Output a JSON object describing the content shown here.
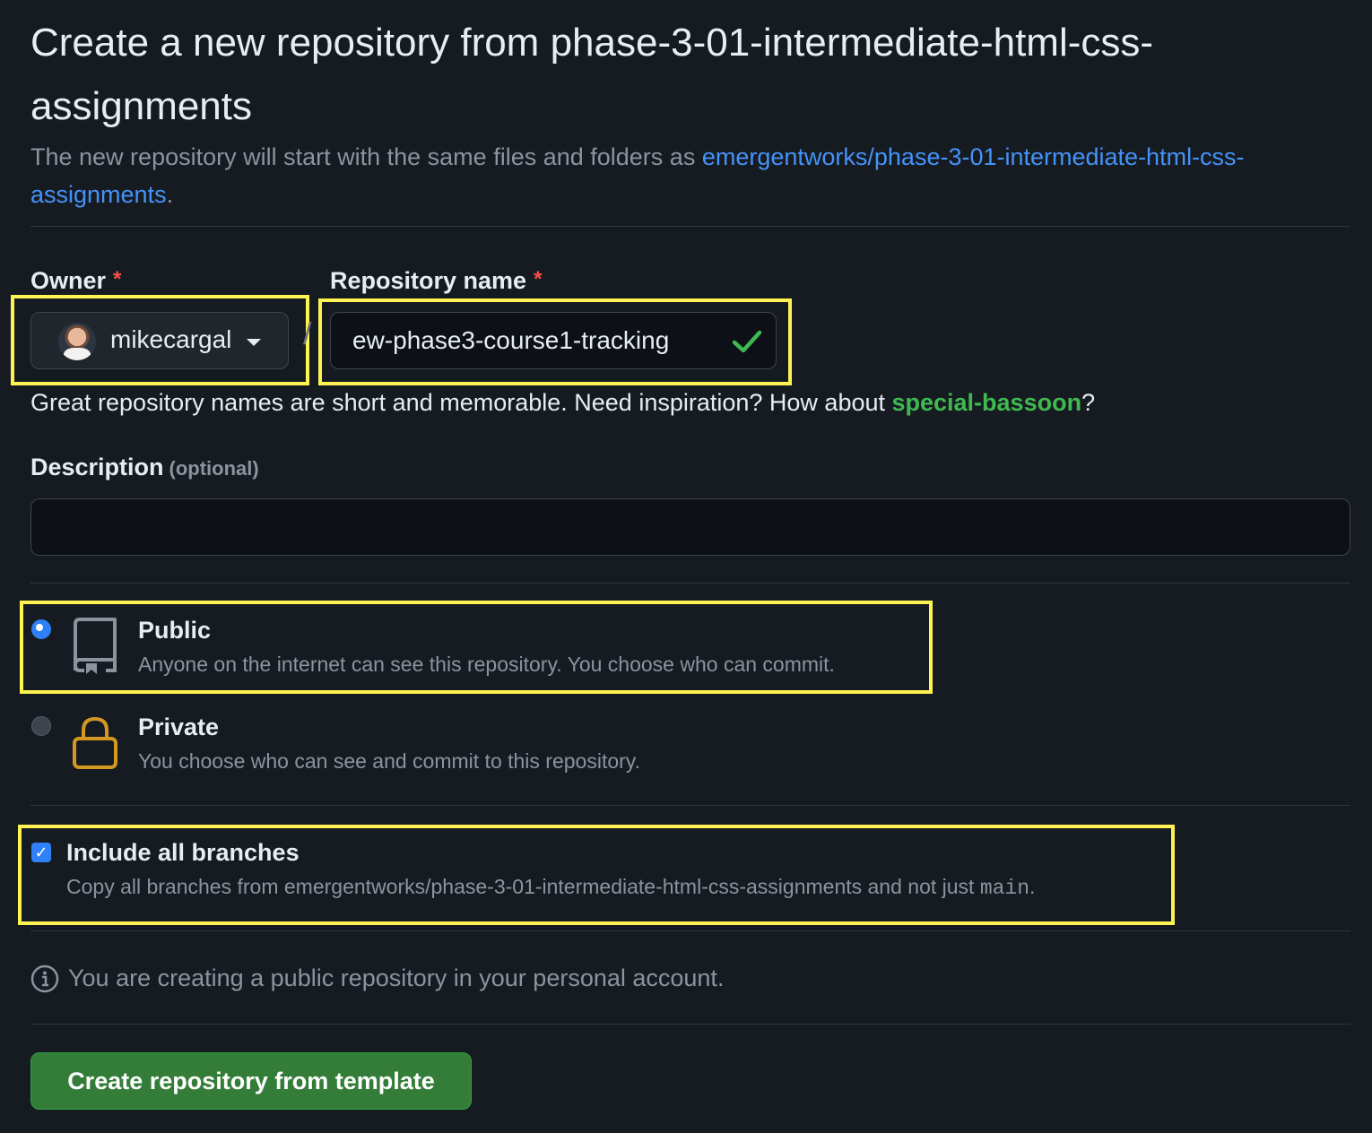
{
  "header": {
    "title": "Create a new repository from phase-3-01-intermediate-html-css-assignments",
    "subtitle_prefix": "The new repository will start with the same files and folders as ",
    "template_link": "emergentworks/phase-3-01-intermediate-html-css-assignments",
    "subtitle_suffix": "."
  },
  "owner": {
    "label": "Owner",
    "required_mark": "*",
    "value": "mikecargal"
  },
  "repo_name": {
    "label": "Repository name",
    "required_mark": "*",
    "value": "ew-phase3-course1-tracking",
    "separator": "/"
  },
  "helper": {
    "text": "Great repository names are short and memorable. Need inspiration? How about ",
    "suggestion": "special-bassoon",
    "suffix": "?"
  },
  "description": {
    "label": "Description",
    "optional": "(optional)",
    "value": ""
  },
  "visibility": {
    "public": {
      "title": "Public",
      "desc": "Anyone on the internet can see this repository. You choose who can commit.",
      "selected": true
    },
    "private": {
      "title": "Private",
      "desc": "You choose who can see and commit to this repository.",
      "selected": false
    }
  },
  "branches": {
    "title": "Include all branches",
    "desc_prefix": "Copy all branches from emergentworks/phase-3-01-intermediate-html-css-assignments and not just ",
    "branch": "main",
    "desc_suffix": ".",
    "checked": true
  },
  "info": {
    "text": "You are creating a public repository in your personal account."
  },
  "submit": {
    "label": "Create repository from template"
  },
  "colors": {
    "background": "#161b22",
    "link": "#4493f8",
    "suggestion": "#3fb950",
    "highlight": "#fff352",
    "button": "#347d39"
  }
}
